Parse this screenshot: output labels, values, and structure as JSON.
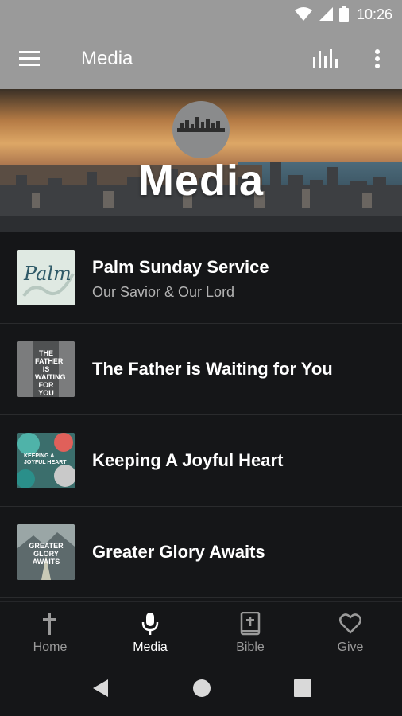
{
  "status_bar": {
    "time": "10:26",
    "icons": [
      "wifi-icon",
      "signal-icon",
      "battery-icon"
    ]
  },
  "app_bar": {
    "title": "Media",
    "left_icon": "hamburger-menu-icon",
    "right_icons": [
      "equalizer-icon",
      "more-vert-icon"
    ],
    "background": "#9a9a9a"
  },
  "hero": {
    "title": "Media"
  },
  "media_items": [
    {
      "title": "Palm Sunday Service",
      "subtitle": "Our Savior & Our Lord",
      "thumb_text": "Palm"
    },
    {
      "title": "The Father is Waiting for You",
      "subtitle": "",
      "thumb_text": "THE FATHER IS WAITING FOR YOU"
    },
    {
      "title": "Keeping A Joyful Heart",
      "subtitle": "",
      "thumb_text": "KEEPING A JOYFUL HEART"
    },
    {
      "title": "Greater Glory Awaits",
      "subtitle": "",
      "thumb_text": "GREATER GLORY AWAITS"
    }
  ],
  "bottom_nav": {
    "active": "Media",
    "items": [
      {
        "label": "Home",
        "icon": "cross-icon"
      },
      {
        "label": "Media",
        "icon": "microphone-icon"
      },
      {
        "label": "Bible",
        "icon": "bible-icon"
      },
      {
        "label": "Give",
        "icon": "heart-icon"
      }
    ]
  },
  "system_nav": {
    "icons": [
      "back-triangle-icon",
      "home-circle-icon",
      "recents-square-icon"
    ]
  },
  "colors": {
    "background": "#151618",
    "divider": "#2a2b2d",
    "text_primary": "#ffffff",
    "text_secondary": "#b3b3b3",
    "nav_inactive": "#9a9a9a"
  }
}
